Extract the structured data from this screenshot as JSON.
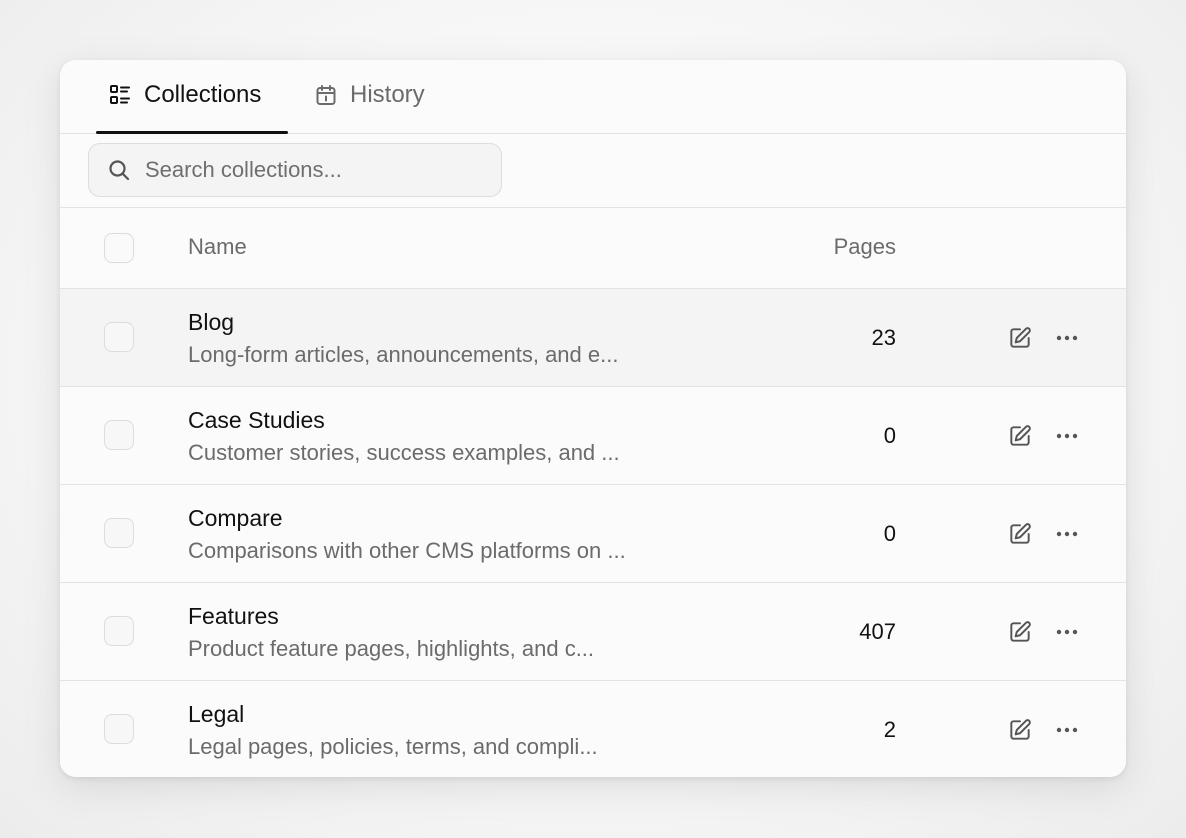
{
  "tabs": [
    {
      "label": "Collections",
      "icon": "list-icon",
      "active": true
    },
    {
      "label": "History",
      "icon": "calendar-icon",
      "active": false
    }
  ],
  "search": {
    "placeholder": "Search collections...",
    "value": "",
    "icon": "search-icon"
  },
  "table": {
    "columns": {
      "name": "Name",
      "pages": "Pages"
    },
    "rows": [
      {
        "title": "Blog",
        "description": "Long-form articles, announcements, and e...",
        "pages": "23"
      },
      {
        "title": "Case Studies",
        "description": "Customer stories, success examples, and ...",
        "pages": "0"
      },
      {
        "title": "Compare",
        "description": "Comparisons with other CMS platforms on ...",
        "pages": "0"
      },
      {
        "title": "Features",
        "description": "Product feature pages, highlights, and c...",
        "pages": "407"
      },
      {
        "title": "Legal",
        "description": "Legal pages, policies, terms, and compli...",
        "pages": "2"
      }
    ],
    "row_actions": {
      "edit_icon": "edit-icon",
      "more_icon": "more-icon"
    }
  },
  "colors": {
    "active_tab": "#111111",
    "inactive_tab": "#6b6b6b",
    "border": "#e3e3e3",
    "hover_row": "#f4f4f4"
  }
}
